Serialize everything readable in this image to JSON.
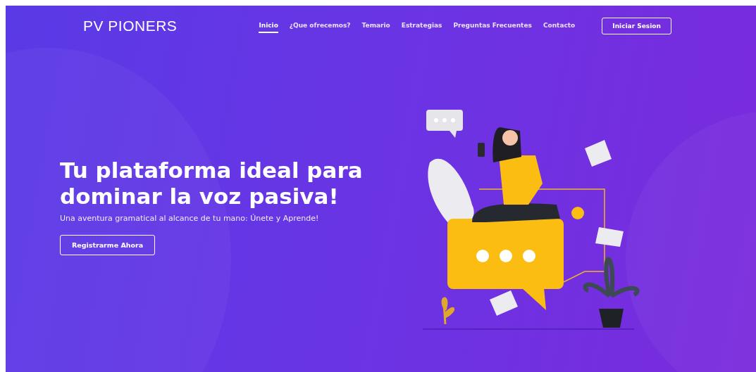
{
  "brand": "PV PIONERS",
  "nav": [
    {
      "label": "Inicio",
      "selected": true
    },
    {
      "label": "¿Que ofrecemos?",
      "selected": false
    },
    {
      "label": "Temario",
      "selected": false
    },
    {
      "label": "Estrategias",
      "selected": false
    },
    {
      "label": "Preguntas Frecuentes",
      "selected": false
    },
    {
      "label": "Contacto",
      "selected": false
    }
  ],
  "login_button": "Iniciar Sesion",
  "hero": {
    "heading": "Tu plataforma ideal para dominar la voz pasiva!",
    "subtitle": "Una aventura gramatical al alcance de tu mano: Únete y Aprende!",
    "button": "Registrarme Ahora"
  }
}
